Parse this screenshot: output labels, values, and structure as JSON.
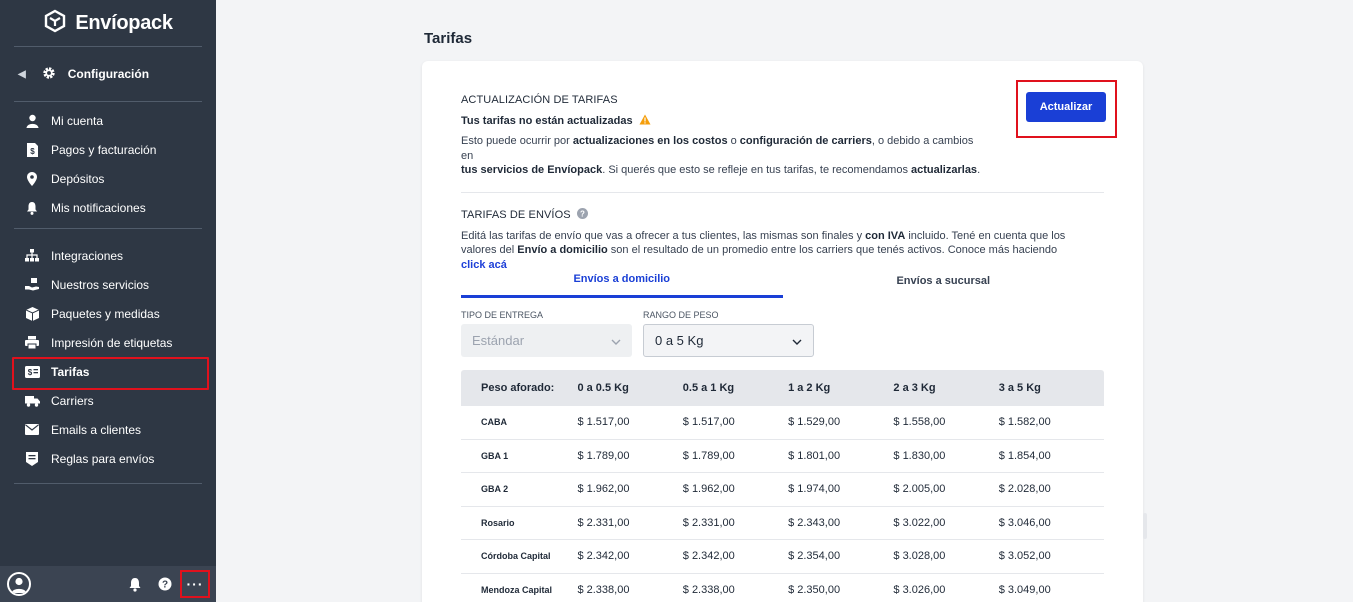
{
  "app": {
    "brand": "Envíopack",
    "config_label": "Configuración"
  },
  "sidebar": {
    "group1": [
      {
        "label": "Mi cuenta",
        "icon": "user-icon"
      },
      {
        "label": "Pagos y facturación",
        "icon": "invoice-icon"
      },
      {
        "label": "Depósitos",
        "icon": "location-pin-icon"
      },
      {
        "label": "Mis notificaciones",
        "icon": "bell-icon"
      }
    ],
    "group2": [
      {
        "label": "Integraciones",
        "icon": "sitemap-icon"
      },
      {
        "label": "Nuestros servicios",
        "icon": "hand-box-icon"
      },
      {
        "label": "Paquetes y medidas",
        "icon": "box-icon"
      },
      {
        "label": "Impresión de etiquetas",
        "icon": "printer-icon"
      },
      {
        "label": "Tarifas",
        "icon": "money-icon",
        "active": true
      },
      {
        "label": "Carriers",
        "icon": "truck-icon"
      },
      {
        "label": "Emails a clientes",
        "icon": "envelope-icon"
      },
      {
        "label": "Reglas para envíos",
        "icon": "rules-icon"
      }
    ],
    "bottom": {
      "more": "···"
    }
  },
  "main": {
    "page_title": "Tarifas",
    "update_section": {
      "title": "ACTUALIZACIÓN DE TARIFAS",
      "warning": "Tus tarifas no están actualizadas",
      "desc_1": "Esto puede ocurrir por ",
      "desc_b1": "actualizaciones en los costos",
      "desc_2": " o ",
      "desc_b2": "configuración de carriers",
      "desc_3": ", o debido a cambios en",
      "desc_b3": "tus servicios de Envíopack",
      "desc_4": ". Si querés que esto se refleje en tus tarifas, te recomendamos ",
      "desc_b4": "actualizarlas",
      "desc_5": ".",
      "button": "Actualizar"
    },
    "rates_section": {
      "title": "TARIFAS DE ENVÍOS",
      "desc_1": "Editá las tarifas de envío que vas a ofrecer a tus clientes, las mismas son finales y ",
      "desc_b1": "con IVA",
      "desc_2": " incluido. Tené en cuenta que los valores del ",
      "desc_b2": "Envío a domicilio",
      "desc_3": " son el resultado de un promedio entre los carriers que tenés activos. Conoce más haciendo",
      "link": "click acá"
    },
    "tabs": [
      {
        "label": "Envíos a domicilio",
        "active": true
      },
      {
        "label": "Envíos a sucursal",
        "active": false
      }
    ],
    "filters": {
      "delivery_type": {
        "label": "TIPO DE ENTREGA",
        "value": "Estándar"
      },
      "weight_range": {
        "label": "RANGO DE PESO",
        "value": "0 a 5 Kg"
      }
    },
    "table": {
      "headers": [
        "Peso aforado:",
        "0 a 0.5 Kg",
        "0.5 a 1 Kg",
        "1 a 2 Kg",
        "2 a 3 Kg",
        "3 a 5 Kg"
      ],
      "rows": [
        {
          "zone": "CABA",
          "values": [
            "$ 1.517,00",
            "$ 1.517,00",
            "$ 1.529,00",
            "$ 1.558,00",
            "$ 1.582,00"
          ]
        },
        {
          "zone": "GBA 1",
          "values": [
            "$ 1.789,00",
            "$ 1.789,00",
            "$ 1.801,00",
            "$ 1.830,00",
            "$ 1.854,00"
          ]
        },
        {
          "zone": "GBA 2",
          "values": [
            "$ 1.962,00",
            "$ 1.962,00",
            "$ 1.974,00",
            "$ 2.005,00",
            "$ 2.028,00"
          ]
        },
        {
          "zone": "Rosario",
          "values": [
            "$ 2.331,00",
            "$ 2.331,00",
            "$ 2.343,00",
            "$ 3.022,00",
            "$ 3.046,00"
          ]
        },
        {
          "zone": "Córdoba Capital",
          "values": [
            "$ 2.342,00",
            "$ 2.342,00",
            "$ 2.354,00",
            "$ 3.028,00",
            "$ 3.052,00"
          ]
        },
        {
          "zone": "Mendoza Capital",
          "values": [
            "$ 2.338,00",
            "$ 2.338,00",
            "$ 2.350,00",
            "$ 3.026,00",
            "$ 3.049,00"
          ]
        }
      ]
    }
  },
  "colors": {
    "sidebar_bg": "#2e3744",
    "accent": "#1a3fd6",
    "highlight": "#e0111d",
    "warning": "#f59e0b"
  }
}
